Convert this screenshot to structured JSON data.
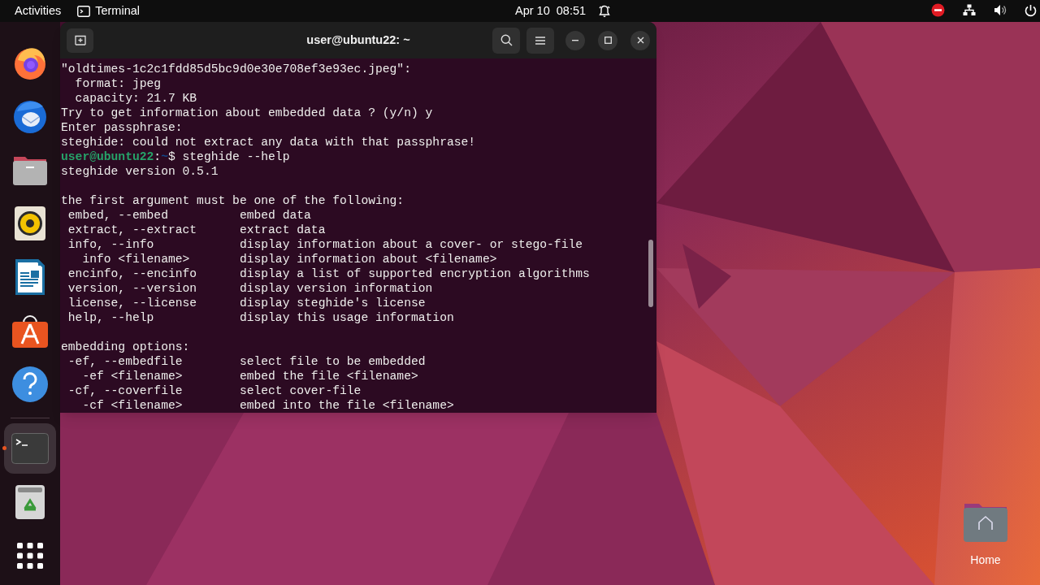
{
  "top_bar": {
    "activities": "Activities",
    "app_name": "Terminal",
    "clock": "Apr 10  08:51"
  },
  "dock": {
    "items": [
      {
        "kind": "firefox",
        "running": false
      },
      {
        "kind": "thunderbird",
        "running": false
      },
      {
        "kind": "files",
        "running": false
      },
      {
        "kind": "rhythmbox",
        "running": false
      },
      {
        "kind": "writer",
        "running": false
      },
      {
        "kind": "software",
        "running": false
      },
      {
        "kind": "help",
        "running": false
      },
      {
        "kind": "separator"
      },
      {
        "kind": "terminal",
        "running": true
      },
      {
        "kind": "trash",
        "running": false
      },
      {
        "kind": "apps",
        "running": false
      }
    ]
  },
  "terminal": {
    "title": "user@ubuntu22: ~",
    "lines": [
      {
        "kind": "text",
        "text": "\"oldtimes-1c2c1fdd85d5bc9d0e30e708ef3e93ec.jpeg\":"
      },
      {
        "kind": "text",
        "text": "  format: jpeg"
      },
      {
        "kind": "text",
        "text": "  capacity: 21.7 KB"
      },
      {
        "kind": "text",
        "text": "Try to get information about embedded data ? (y/n) y"
      },
      {
        "kind": "text",
        "text": "Enter passphrase:"
      },
      {
        "kind": "text",
        "text": "steghide: could not extract any data with that passphrase!"
      },
      {
        "kind": "prompt",
        "user": "user@ubuntu22",
        "sep": ":",
        "path": "~",
        "command": "$ steghide --help"
      },
      {
        "kind": "text",
        "text": "steghide version 0.5.1"
      },
      {
        "kind": "blank"
      },
      {
        "kind": "text",
        "text": "the first argument must be one of the following:"
      },
      {
        "kind": "text",
        "text": " embed, --embed          embed data"
      },
      {
        "kind": "text",
        "text": " extract, --extract      extract data"
      },
      {
        "kind": "text",
        "text": " info, --info            display information about a cover- or stego-file"
      },
      {
        "kind": "text",
        "text": "   info <filename>       display information about <filename>"
      },
      {
        "kind": "text",
        "text": " encinfo, --encinfo      display a list of supported encryption algorithms"
      },
      {
        "kind": "text",
        "text": " version, --version      display version information"
      },
      {
        "kind": "text",
        "text": " license, --license      display steghide's license"
      },
      {
        "kind": "text",
        "text": " help, --help            display this usage information"
      },
      {
        "kind": "blank"
      },
      {
        "kind": "text",
        "text": "embedding options:"
      },
      {
        "kind": "text",
        "text": " -ef, --embedfile        select file to be embedded"
      },
      {
        "kind": "text",
        "text": "   -ef <filename>        embed the file <filename>"
      },
      {
        "kind": "text",
        "text": " -cf, --coverfile        select cover-file"
      },
      {
        "kind": "text",
        "text": "   -cf <filename>        embed into the file <filename>"
      }
    ]
  },
  "desktop_icons": [
    {
      "label": "Home"
    }
  ]
}
